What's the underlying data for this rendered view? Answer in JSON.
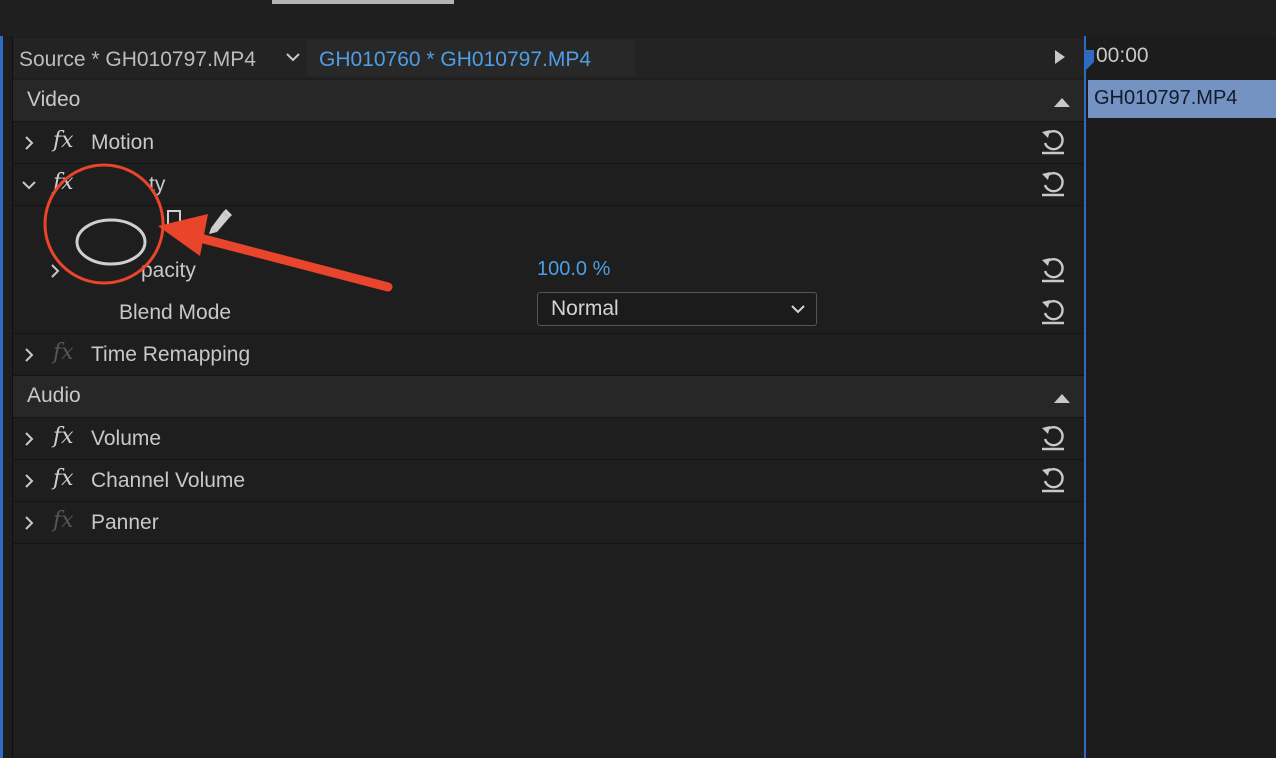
{
  "tabs": {
    "source_label": "Source * GH010797.MP4",
    "active_label": "GH010760 * GH010797.MP4"
  },
  "sections": {
    "video": "Video",
    "audio": "Audio"
  },
  "video_effects": {
    "motion": "Motion",
    "opacity_header": "ty",
    "opacity_param": "pacity",
    "opacity_value": "100.0 %",
    "blend_mode_label": "Blend Mode",
    "blend_mode_value": "Normal",
    "time_remapping": "Time Remapping"
  },
  "audio_effects": {
    "volume": "Volume",
    "channel_volume": "Channel Volume",
    "panner": "Panner"
  },
  "fx_symbol": "fx",
  "timeline": {
    "timecode": "00:00",
    "clip_name": "GH010797.MP4"
  },
  "colors": {
    "accent_blue": "#4f9de6",
    "clip_blue": "#7493c2",
    "annotation_red": "#e8452c"
  },
  "icons": {
    "reset": "reset-icon",
    "ellipse_mask": "ellipse-mask-icon",
    "rect_mask": "rectangle-mask-icon",
    "pen": "pen-icon"
  }
}
